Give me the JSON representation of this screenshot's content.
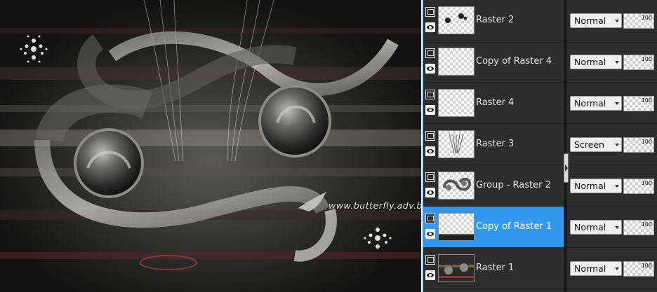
{
  "canvas": {
    "watermark": "www.butterfly.adv.br"
  },
  "layers": [
    {
      "name": "Raster 2",
      "blend": "Normal",
      "opacity": "100",
      "selected": false,
      "thumb": "dots"
    },
    {
      "name": "Copy of Raster 4",
      "blend": "Normal",
      "opacity": "100",
      "selected": false,
      "thumb": "empty"
    },
    {
      "name": "Raster 4",
      "blend": "Normal",
      "opacity": "100",
      "selected": false,
      "thumb": "empty"
    },
    {
      "name": "Raster 3",
      "blend": "Screen",
      "opacity": "100",
      "selected": false,
      "thumb": "rays"
    },
    {
      "name": "Group - Raster 2",
      "blend": "Normal",
      "opacity": "100",
      "selected": false,
      "thumb": "swirl"
    },
    {
      "name": "Copy of Raster 1",
      "blend": "Normal",
      "opacity": "100",
      "selected": true,
      "thumb": "floor"
    },
    {
      "name": "Raster 1",
      "blend": "Normal",
      "opacity": "100",
      "selected": false,
      "thumb": "scene"
    }
  ],
  "colors": {
    "selection": "#3399ee",
    "panel_bg": "#2d2d2d",
    "canvas_border": "#ffffff"
  },
  "icons": {
    "group": "layer-group-icon",
    "visibility": "eye-icon",
    "dropdown": "chevron-down-icon",
    "splitter": "panel-collapse-icon"
  }
}
